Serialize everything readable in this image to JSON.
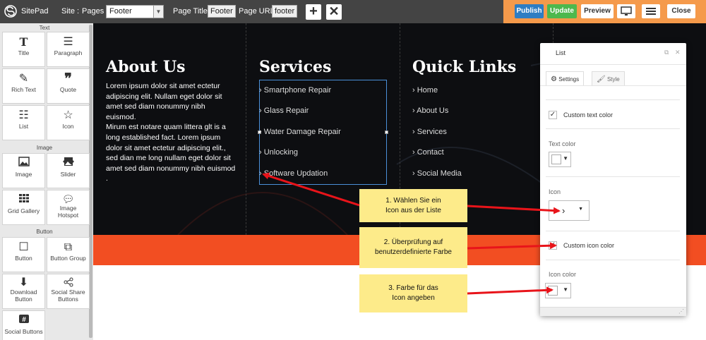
{
  "topbar": {
    "app_name": "SitePad",
    "site_label": "Site :",
    "pages_label": "Pages :",
    "pages_value": "Footer",
    "page_title_label": "Page Title:",
    "page_title_value": "Footer",
    "page_url_label": "Page URL:",
    "page_url_value": "footer",
    "publish": "Publish",
    "update": "Update",
    "preview": "Preview",
    "close": "Close"
  },
  "sidebar": {
    "sections": {
      "text": "Text",
      "image": "Image",
      "button": "Button"
    },
    "tiles": {
      "title": "Title",
      "paragraph": "Paragraph",
      "rich_text": "Rich Text",
      "quote": "Quote",
      "list": "List",
      "icon": "Icon",
      "image": "Image",
      "slider": "Slider",
      "grid_gallery": "Grid Gallery",
      "image_hotspot_1": "Image",
      "image_hotspot_2": "Hotspot",
      "button": "Button",
      "button_group": "Button Group",
      "download_1": "Download",
      "download_2": "Button",
      "social_share_1": "Social Share",
      "social_share_2": "Buttons",
      "social_buttons": "Social Buttons"
    }
  },
  "canvas": {
    "about": {
      "heading": "About Us",
      "lines": [
        "Lorem ipsum dolor sit amet ectetur",
        "adipiscing elit. Nullam eget dolor sit",
        "amet sed diam nonummy nibh",
        "euismod.",
        "Mirum est notare quam littera glt is a",
        "long established fact. Lorem ipsum",
        "dolor sit amet ectetur adipiscing elit.,",
        "sed dian me long nullam eget dolor sit",
        "amet sed diam nonummy nibh euismod",
        "."
      ]
    },
    "services": {
      "heading": "Services",
      "items": [
        "Smartphone Repair",
        "Glass Repair",
        "Water Damage Repair",
        "Unlocking",
        "Software Updation"
      ]
    },
    "quick_links": {
      "heading": "Quick Links",
      "items": [
        "Home",
        "About Us",
        "Services",
        "Contact",
        "Social Media"
      ]
    }
  },
  "panel": {
    "title": "List",
    "tab_settings": "Settings",
    "tab_style": "Style",
    "custom_text_color": "Custom text color",
    "text_color": "Text color",
    "icon": "Icon",
    "custom_icon_color": "Custom icon color",
    "icon_color": "Icon color"
  },
  "callouts": {
    "c1_l1": "1. Wählen Sie ein",
    "c1_l2": "Icon aus der Liste",
    "c2_l1": "2. Überprüfung auf",
    "c2_l2": "benutzerdefinierte Farbe",
    "c3_l1": "3. Farbe für das",
    "c3_l2": "Icon angeben"
  },
  "colors": {
    "topbar": "#444444",
    "orange_header": "#f59a4b",
    "publish": "#2e7dc3",
    "update": "#4db84d",
    "footer_dark": "#0d0e11",
    "footer_orange": "#f24e22",
    "callout": "#fdeb8a",
    "arrow": "#e8141a"
  }
}
